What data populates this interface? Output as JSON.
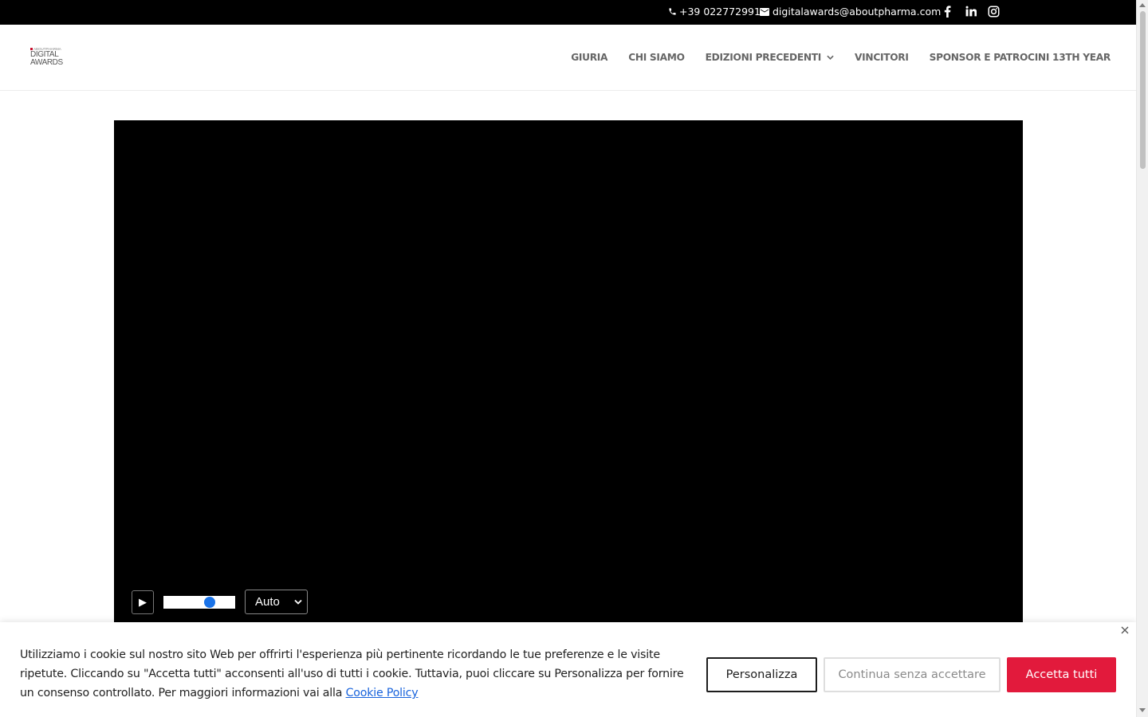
{
  "topbar": {
    "phone": "+39 022772991",
    "email": "digitalawards@aboutpharma.com",
    "social": [
      "facebook-icon",
      "linkedin-icon",
      "instagram-icon"
    ]
  },
  "logo": {
    "line1": "ABOUTPHARMA",
    "line2": "DIGITAL",
    "line3": "AWARDS"
  },
  "nav": {
    "items": [
      {
        "label": "GIURIA"
      },
      {
        "label": "CHI SIAMO"
      },
      {
        "label": "EDIZIONI PRECEDENTI",
        "has_dropdown": true
      },
      {
        "label": "VINCITORI"
      },
      {
        "label": "SPONSOR E PATROCINI 13TH YEAR"
      }
    ]
  },
  "video": {
    "play_symbol": "▶",
    "volume_level": 0.67,
    "quality_selected": "Auto"
  },
  "cookie": {
    "text": "Utilizziamo i cookie sul nostro sito Web per offrirti l'esperienza più pertinente ricordando le tue preferenze e le visite ripetute. Cliccando su \"Accetta tutti\" acconsenti all'uso di tutti i cookie. Tuttavia, puoi cliccare su Personalizza per fornire un consenso controllato. Per maggiori informazioni vai alla",
    "link": "Cookie Policy",
    "customize": "Personalizza",
    "reject": "Continua senza accettare",
    "accept": "Accetta tutti"
  },
  "colors": {
    "topbar_bg": "#000000",
    "nav_text": "#666666",
    "accept_bg": "#e21a3c",
    "link": "#1863dc",
    "slider_knob": "#1a73e8"
  }
}
